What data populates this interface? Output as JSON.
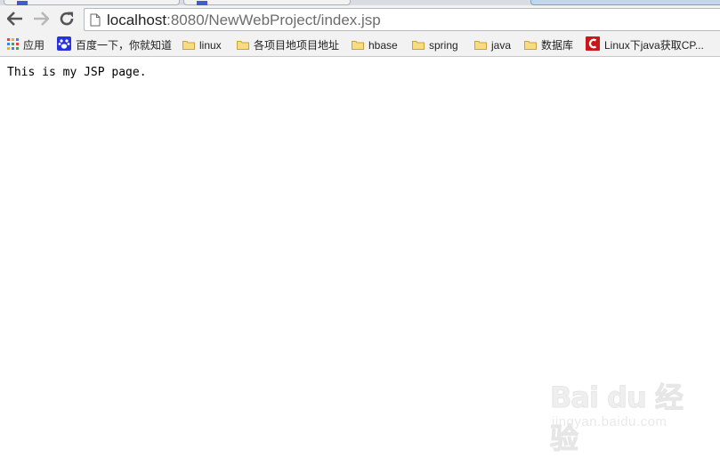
{
  "browser": {
    "address_host": "localhost",
    "address_rest": ":8080/NewWebProject/index.jsp",
    "icons": {
      "back": "back-arrow-icon",
      "forward": "forward-arrow-icon",
      "reload": "reload-icon",
      "page": "page-icon"
    }
  },
  "bookmarks": [
    {
      "label": "应用",
      "icon": "apps-grid-icon"
    },
    {
      "label": "百度一下，你就知道",
      "icon": "baidu-paw-icon"
    },
    {
      "label": "linux",
      "icon": "folder-icon"
    },
    {
      "label": "各项目地项目地址",
      "icon": "folder-icon"
    },
    {
      "label": "hbase",
      "icon": "folder-icon"
    },
    {
      "label": "spring",
      "icon": "folder-icon"
    },
    {
      "label": "java",
      "icon": "folder-icon"
    },
    {
      "label": "数据库",
      "icon": "folder-icon"
    },
    {
      "label": "Linux下java获取CP...",
      "icon": "csdn-icon"
    }
  ],
  "page": {
    "text": "This is my JSP page."
  },
  "watermark": {
    "logo": "Bai du 经验",
    "sub": "jingyan.baidu.com"
  },
  "colors": {
    "chrome_bg": "#f2f2f2",
    "folder": "#e7c35b",
    "baidu_blue": "#2932e1",
    "csdn_red": "#c9181b"
  }
}
